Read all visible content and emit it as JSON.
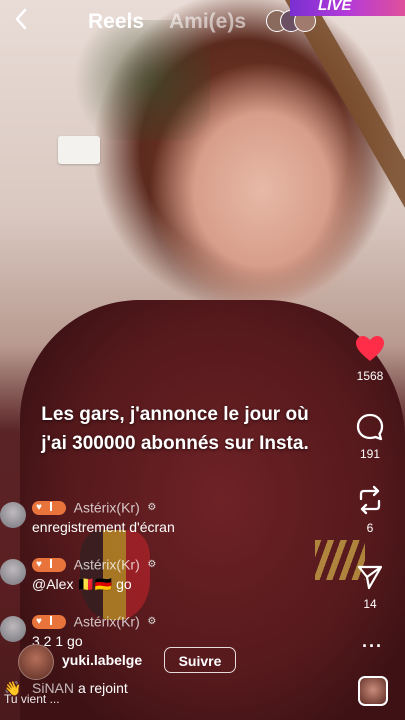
{
  "header": {
    "tabs": [
      {
        "label": "Reels"
      },
      {
        "label": "Ami(e)s"
      }
    ],
    "live_badge": "LIVE"
  },
  "caption": "Les gars, j'annonce le jour où j'ai 300000 abonnés sur Insta.",
  "actions": {
    "likes": "1568",
    "comments": "191",
    "reposts": "6",
    "shares": "14",
    "like_color": "#ff2d48"
  },
  "comments": [
    {
      "user": "Astérix(Kr)",
      "text": "enregistrement d'écran"
    },
    {
      "user": "Astérix(Kr)",
      "text": "@Alex 🇧🇪🇩🇪 go"
    },
    {
      "user": "Astérix(Kr)",
      "text": "3 2 1 go"
    }
  ],
  "host": {
    "name": "yuki.labelge",
    "follow_label": "Suivre"
  },
  "joined": {
    "name": "SiNAN",
    "message": "a rejoint"
  },
  "input_placeholder": "Tu vient ..."
}
